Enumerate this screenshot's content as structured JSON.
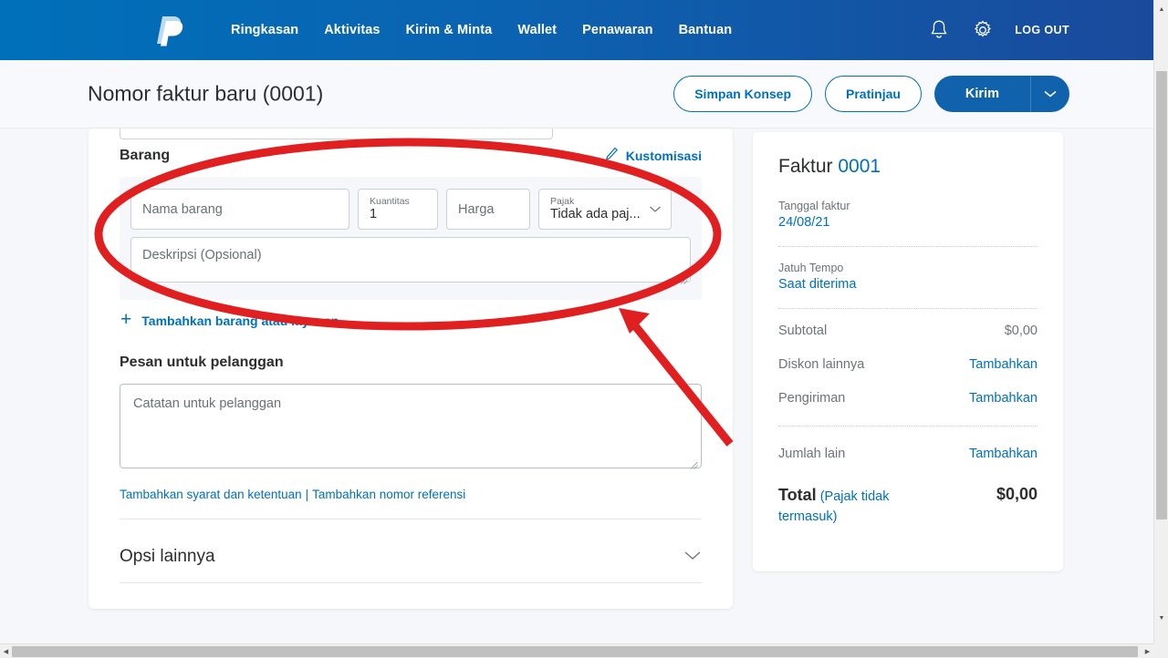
{
  "nav": {
    "logo": "paypal-logo",
    "links": [
      {
        "label": "Ringkasan"
      },
      {
        "label": "Aktivitas"
      },
      {
        "label": "Kirim & Minta"
      },
      {
        "label": "Wallet"
      },
      {
        "label": "Penawaran"
      },
      {
        "label": "Bantuan"
      }
    ],
    "bell_icon": "bell-icon",
    "gear_icon": "gear-icon",
    "logout_label": "LOG OUT"
  },
  "subheader": {
    "title": "Nomor faktur baru (0001)",
    "save_draft_label": "Simpan Konsep",
    "preview_label": "Pratinjau",
    "send_label": "Kirim",
    "send_caret_icon": "chevron-down-icon"
  },
  "items_section": {
    "title": "Barang",
    "customize_label": "Kustomisasi",
    "customize_icon": "pencil-icon",
    "item_name_placeholder": "Nama barang",
    "quantity_label": "Kuantitas",
    "quantity_value": "1",
    "price_placeholder": "Harga",
    "tax_label": "Pajak",
    "tax_value": "Tidak ada paj...",
    "tax_caret_icon": "chevron-down-icon",
    "description_placeholder": "Deskripsi (Opsional)",
    "add_item_label": "Tambahkan barang atau layanan",
    "add_item_icon": "plus-icon"
  },
  "message_section": {
    "label": "Pesan untuk pelanggan",
    "placeholder": "Catatan untuk pelanggan"
  },
  "footer_links": {
    "terms_label": "Tambahkan syarat dan ketentuan",
    "separator": "|",
    "reference_label": "Tambahkan nomor referensi"
  },
  "more_options": {
    "label": "Opsi lainnya",
    "caret_icon": "chevron-down-icon"
  },
  "invoice_panel": {
    "title_prefix": "Faktur",
    "number": "0001",
    "invoice_date_label": "Tanggal faktur",
    "invoice_date_value": "24/08/21",
    "due_label": "Jatuh Tempo",
    "due_value": "Saat diterima",
    "rows": [
      {
        "label": "Subtotal",
        "value": "$0,00",
        "is_action": false
      },
      {
        "label": "Diskon lainnya",
        "value": "Tambahkan",
        "is_action": true
      },
      {
        "label": "Pengiriman",
        "value": "Tambahkan",
        "is_action": true
      }
    ],
    "other_amount_label": "Jumlah lain",
    "other_amount_action": "Tambahkan",
    "total_label": "Total",
    "total_note": "(Pajak tidak termasuk)",
    "total_value": "$0,00"
  },
  "annotations": {
    "ellipse": "red-ellipse-highlight",
    "arrow": "red-arrow-pointer",
    "color": "#e02020"
  },
  "colors": {
    "brand_blue": "#0070ba",
    "header_gradient_start": "#0070ba",
    "header_gradient_end": "#1a4a9c",
    "page_background": "#f5f7fa",
    "text_dark": "#2c2e2f",
    "text_muted": "#6c7378"
  }
}
